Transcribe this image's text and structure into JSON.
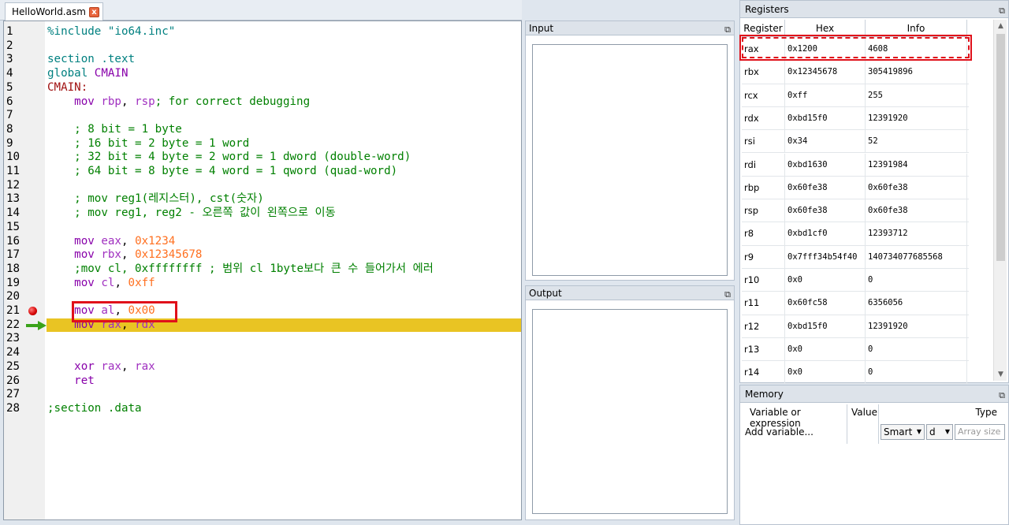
{
  "editor": {
    "tab_title": "HelloWorld.asm",
    "tab_close": "x",
    "lines": [
      {
        "n": "1",
        "tokens": [
          {
            "t": "%include \"io64.inc\"",
            "c": "tok-pre"
          }
        ]
      },
      {
        "n": "2",
        "tokens": []
      },
      {
        "n": "3",
        "tokens": [
          {
            "t": "section .text",
            "c": "tok-dir"
          }
        ]
      },
      {
        "n": "4",
        "tokens": [
          {
            "t": "global ",
            "c": "tok-dir"
          },
          {
            "t": "CMAIN",
            "c": "tok-instr"
          }
        ]
      },
      {
        "n": "5",
        "tokens": [
          {
            "t": "CMAIN:",
            "c": "tok-label"
          }
        ]
      },
      {
        "n": "6",
        "tokens": [
          {
            "t": "    mov ",
            "c": "tok-instr"
          },
          {
            "t": "rbp",
            "c": "tok-reg"
          },
          {
            "t": ", ",
            "c": "tok-plain"
          },
          {
            "t": "rsp",
            "c": "tok-reg"
          },
          {
            "t": "; for correct debugging",
            "c": "tok-comment"
          }
        ]
      },
      {
        "n": "7",
        "tokens": []
      },
      {
        "n": "8",
        "tokens": [
          {
            "t": "    ; 8 bit = 1 byte",
            "c": "tok-comment"
          }
        ]
      },
      {
        "n": "9",
        "tokens": [
          {
            "t": "    ; 16 bit = 2 byte = 1 word",
            "c": "tok-comment"
          }
        ]
      },
      {
        "n": "10",
        "tokens": [
          {
            "t": "    ; 32 bit = 4 byte = 2 word = 1 dword (double-word)",
            "c": "tok-comment"
          }
        ]
      },
      {
        "n": "11",
        "tokens": [
          {
            "t": "    ; 64 bit = 8 byte = 4 word = 1 qword (quad-word)",
            "c": "tok-comment"
          }
        ]
      },
      {
        "n": "12",
        "tokens": []
      },
      {
        "n": "13",
        "tokens": [
          {
            "t": "    ; mov reg1(레지스터), cst(숫자)",
            "c": "tok-comment"
          }
        ]
      },
      {
        "n": "14",
        "tokens": [
          {
            "t": "    ; mov reg1, reg2 - 오른쪽 값이 왼쪽으로 이동",
            "c": "tok-comment"
          }
        ]
      },
      {
        "n": "15",
        "tokens": []
      },
      {
        "n": "16",
        "tokens": [
          {
            "t": "    mov ",
            "c": "tok-instr"
          },
          {
            "t": "eax",
            "c": "tok-reg"
          },
          {
            "t": ", ",
            "c": "tok-plain"
          },
          {
            "t": "0x1234",
            "c": "tok-num"
          }
        ]
      },
      {
        "n": "17",
        "tokens": [
          {
            "t": "    mov ",
            "c": "tok-instr"
          },
          {
            "t": "rbx",
            "c": "tok-reg"
          },
          {
            "t": ", ",
            "c": "tok-plain"
          },
          {
            "t": "0x12345678",
            "c": "tok-num"
          }
        ]
      },
      {
        "n": "18",
        "tokens": [
          {
            "t": "    ;mov cl, 0xffffffff ; 범위 cl 1byte보다 큰 수 들어가서 에러",
            "c": "tok-comment"
          }
        ]
      },
      {
        "n": "19",
        "tokens": [
          {
            "t": "    mov ",
            "c": "tok-instr"
          },
          {
            "t": "cl",
            "c": "tok-reg"
          },
          {
            "t": ", ",
            "c": "tok-plain"
          },
          {
            "t": "0xff",
            "c": "tok-num"
          }
        ]
      },
      {
        "n": "20",
        "tokens": []
      },
      {
        "n": "21",
        "tokens": [
          {
            "t": "    mov ",
            "c": "tok-instr"
          },
          {
            "t": "al",
            "c": "tok-reg"
          },
          {
            "t": ", ",
            "c": "tok-plain"
          },
          {
            "t": "0x00",
            "c": "tok-num"
          }
        ]
      },
      {
        "n": "22",
        "tokens": [
          {
            "t": "    mov ",
            "c": "tok-instr"
          },
          {
            "t": "rax",
            "c": "tok-reg"
          },
          {
            "t": ", ",
            "c": "tok-plain"
          },
          {
            "t": "rdx",
            "c": "tok-reg"
          }
        ]
      },
      {
        "n": "23",
        "tokens": []
      },
      {
        "n": "24",
        "tokens": []
      },
      {
        "n": "25",
        "tokens": [
          {
            "t": "    xor ",
            "c": "tok-instr"
          },
          {
            "t": "rax",
            "c": "tok-reg"
          },
          {
            "t": ", ",
            "c": "tok-plain"
          },
          {
            "t": "rax",
            "c": "tok-reg"
          }
        ]
      },
      {
        "n": "26",
        "tokens": [
          {
            "t": "    ret",
            "c": "tok-instr"
          }
        ]
      },
      {
        "n": "27",
        "tokens": []
      },
      {
        "n": "28",
        "tokens": [
          {
            "t": ";section .data",
            "c": "tok-comment"
          }
        ]
      }
    ],
    "breakpoint_line": "21",
    "current_line": "22"
  },
  "input_panel": {
    "title": "Input"
  },
  "output_panel": {
    "title": "Output"
  },
  "registers": {
    "title": "Registers",
    "headers": [
      "Register",
      "Hex",
      "Info"
    ],
    "rows": [
      {
        "reg": "rax",
        "hex": "0x1200",
        "info": "4608"
      },
      {
        "reg": "rbx",
        "hex": "0x12345678",
        "info": "305419896"
      },
      {
        "reg": "rcx",
        "hex": "0xff",
        "info": "255"
      },
      {
        "reg": "rdx",
        "hex": "0xbd15f0",
        "info": "12391920"
      },
      {
        "reg": "rsi",
        "hex": "0x34",
        "info": "52"
      },
      {
        "reg": "rdi",
        "hex": "0xbd1630",
        "info": "12391984"
      },
      {
        "reg": "rbp",
        "hex": "0x60fe38",
        "info": "0x60fe38"
      },
      {
        "reg": "rsp",
        "hex": "0x60fe38",
        "info": "0x60fe38"
      },
      {
        "reg": "r8",
        "hex": "0xbd1cf0",
        "info": "12393712"
      },
      {
        "reg": "r9",
        "hex": "0x7fff34b54f40",
        "info": "140734077685568"
      },
      {
        "reg": "r10",
        "hex": "0x0",
        "info": "0"
      },
      {
        "reg": "r11",
        "hex": "0x60fc58",
        "info": "6356056"
      },
      {
        "reg": "r12",
        "hex": "0xbd15f0",
        "info": "12391920"
      },
      {
        "reg": "r13",
        "hex": "0x0",
        "info": "0"
      },
      {
        "reg": "r14",
        "hex": "0x0",
        "info": "0"
      }
    ]
  },
  "memory": {
    "title": "Memory",
    "col_variable": "Variable or expression",
    "col_value": "Value",
    "col_type": "Type",
    "add_variable": "Add variable...",
    "mode_select": "Smart",
    "format_select": "d",
    "array_size_placeholder": "Array size"
  },
  "icons": {
    "float_icon": "⧉",
    "close_icon": "x"
  },
  "colors": {
    "current_line_highlight": "#e9c423",
    "annotation_red": "#e0101a"
  }
}
